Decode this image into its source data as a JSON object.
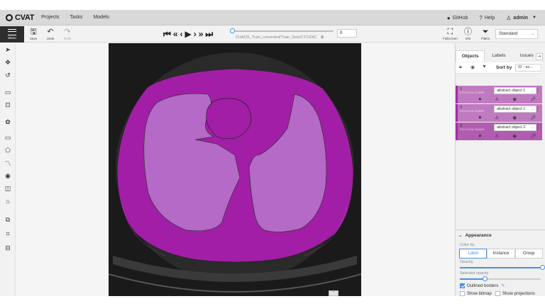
{
  "header": {
    "logo": "CVAT",
    "nav": [
      "Projects",
      "Tasks",
      "Models"
    ],
    "github": "GitHub",
    "help": "Help",
    "user": "admin"
  },
  "toolbar": {
    "menu_label": "Menu",
    "save_label": "Save",
    "undo_label": "Undo",
    "redo_label": "Redo",
    "filename": "CHAOS_Train_converted/Train_Sets/CT/1/DIC",
    "frame": "0",
    "fullscreen_label": "Fullscreen",
    "info_label": "Info",
    "filters_label": "Filters",
    "workspace": "Standard"
  },
  "sidebar": {
    "tabs": [
      "Objects",
      "Labels",
      "Issues"
    ],
    "sort_label": "Sort by",
    "sort_value": "ID - as...",
    "objects": [
      {
        "id": "1",
        "type": "POLYGON SHAPE",
        "label": "abstract object 1"
      },
      {
        "id": "2",
        "type": "POLYGON SHAPE",
        "label": "abstract object 1"
      },
      {
        "id": "3",
        "type": "POLYGON SHAPE",
        "label": "abstract object 2"
      }
    ],
    "object_colors": [
      "#c07ac0",
      "#c07ac0",
      "#b15bb1"
    ]
  },
  "appearance": {
    "title": "Appearance",
    "color_by_label": "Color by",
    "color_by_options": [
      "Label",
      "Instance",
      "Group"
    ],
    "color_by_selected": "Label",
    "opacity_label": "Opacity",
    "opacity": 1.0,
    "selected_opacity_label": "Selected opacity",
    "selected_opacity": 0.5,
    "outlined_borders_label": "Outlined borders",
    "outlined_borders": true,
    "show_bitmap_label": "Show bitmap",
    "show_projections_label": "Show projections"
  },
  "annotation_colors": {
    "body": "#a21ea6",
    "lungs": "#b46ac6"
  }
}
